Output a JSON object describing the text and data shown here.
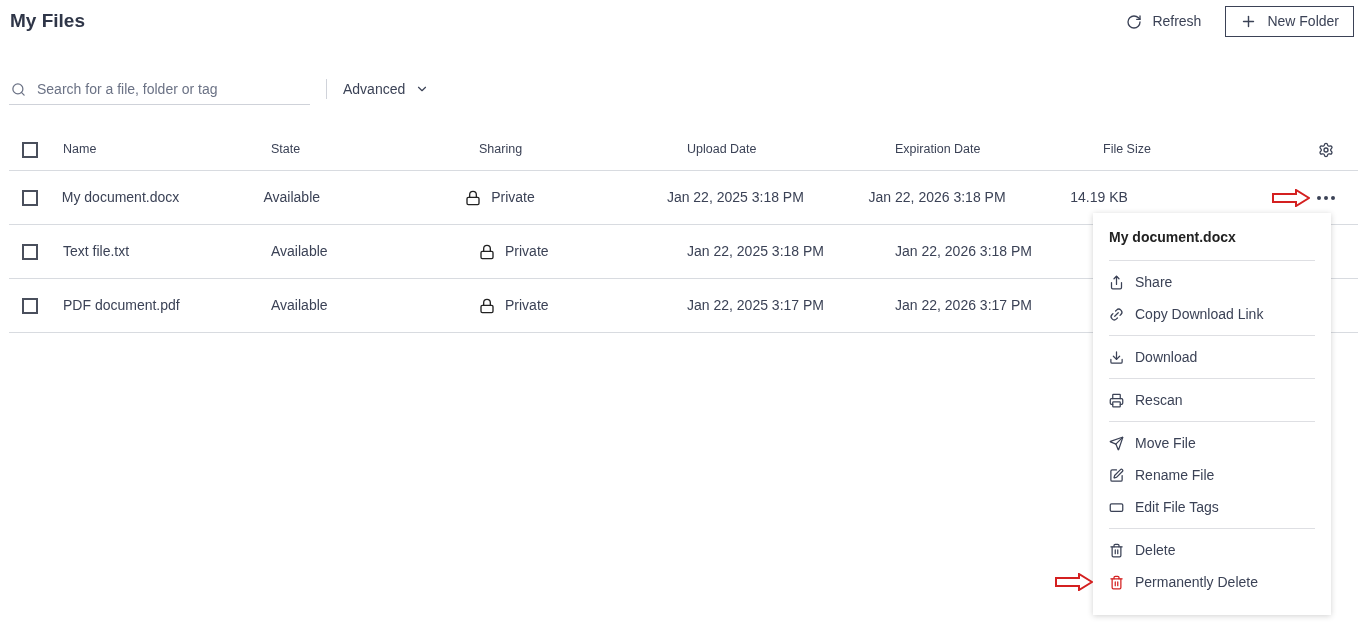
{
  "title": "My Files",
  "actions": {
    "refresh": "Refresh",
    "new_folder": "New Folder"
  },
  "search": {
    "placeholder": "Search for a file, folder or tag"
  },
  "advanced": "Advanced",
  "table": {
    "select_all": {
      "checked": false
    },
    "columns": [
      "Name",
      "State",
      "Sharing",
      "Upload Date",
      "Expiration Date",
      "File Size"
    ],
    "rows": [
      {
        "checked": false,
        "name": "My document.docx",
        "state": "Available",
        "sharing": "Private",
        "upload_date": "Jan 22, 2025 3:18 PM",
        "expiration_date": "Jan 22, 2026 3:18 PM",
        "file_size": "14.19 KB",
        "menu_open": true
      },
      {
        "checked": false,
        "name": "Text file.txt",
        "state": "Available",
        "sharing": "Private",
        "upload_date": "Jan 22, 2025 3:18 PM",
        "expiration_date": "Jan 22, 2026 3:18 PM",
        "menu_open": false
      },
      {
        "checked": false,
        "name": "PDF document.pdf",
        "state": "Available",
        "sharing": "Private",
        "upload_date": "Jan 22, 2025 3:17 PM",
        "expiration_date": "Jan 22, 2026 3:17 PM",
        "menu_open": false
      }
    ]
  },
  "context_menu": {
    "title": "My document.docx",
    "groups": [
      [
        {
          "kind": "share",
          "label": "Share",
          "danger": false
        },
        {
          "kind": "link",
          "label": "Copy Download Link",
          "danger": false
        }
      ],
      [
        {
          "kind": "download",
          "label": "Download",
          "danger": false
        }
      ],
      [
        {
          "kind": "rescan",
          "label": "Rescan",
          "danger": false
        }
      ],
      [
        {
          "kind": "move",
          "label": "Move File",
          "danger": false
        },
        {
          "kind": "rename",
          "label": "Rename File",
          "danger": false
        },
        {
          "kind": "tags",
          "label": "Edit File Tags",
          "danger": false
        }
      ],
      [
        {
          "kind": "delete",
          "label": "Delete",
          "danger": false
        },
        {
          "kind": "delete",
          "label": "Permanently Delete",
          "danger": true
        }
      ]
    ]
  }
}
